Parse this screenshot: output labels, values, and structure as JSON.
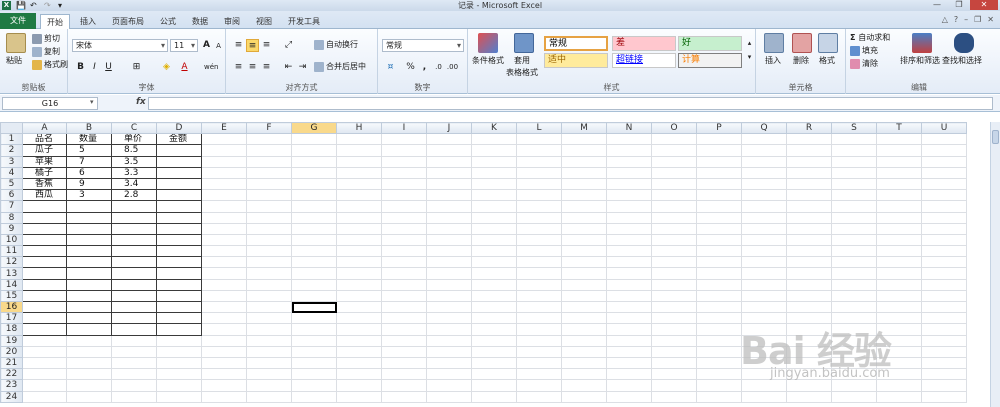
{
  "window": {
    "title": "记录 - Microsoft Excel",
    "minimize": "—",
    "restore": "❐",
    "close": "✕"
  },
  "tabs": {
    "file": "文件",
    "items": [
      "开始",
      "插入",
      "页面布局",
      "公式",
      "数据",
      "审阅",
      "视图",
      "开发工具"
    ],
    "active": "开始"
  },
  "ribbon": {
    "clipboard": {
      "label": "剪贴板",
      "paste": "粘贴",
      "cut": "剪切",
      "copy": "复制",
      "format_painter": "格式刷"
    },
    "font": {
      "label": "字体",
      "font_name": "宋体",
      "font_size": "11",
      "bold": "B",
      "italic": "I",
      "underline": "U",
      "grow": "A",
      "shrink": "A",
      "phonetic": "wén"
    },
    "alignment": {
      "label": "对齐方式",
      "wrap_text": "自动换行",
      "merge_center": "合并后居中"
    },
    "number": {
      "label": "数字",
      "format": "常规",
      "percent": "%",
      "comma": ","
    },
    "styles": {
      "label": "样式",
      "conditional": "条件格式",
      "table_format": "套用",
      "table_format2": "表格格式",
      "cells": [
        {
          "text": "常规",
          "bg": "#ffffff",
          "color": "#000000"
        },
        {
          "text": "差",
          "bg": "#ffc7ce",
          "color": "#9c0006"
        },
        {
          "text": "好",
          "bg": "#c6efce",
          "color": "#006100"
        },
        {
          "text": "适中",
          "bg": "#ffeb9c",
          "color": "#9c6500"
        },
        {
          "text": "超链接",
          "bg": "#ffffff",
          "color": "#0000ff"
        },
        {
          "text": "计算",
          "bg": "#f2f2f2",
          "color": "#fa7d00"
        }
      ]
    },
    "cells_group": {
      "label": "单元格",
      "insert": "插入",
      "delete": "删除",
      "format": "格式"
    },
    "editing": {
      "label": "编辑",
      "autosum": "自动求和",
      "fill": "填充",
      "clear": "清除",
      "sort_filter": "排序和筛选",
      "find_select": "查找和选择"
    }
  },
  "formula_bar": {
    "name_box": "G16",
    "fx": "fx",
    "value": ""
  },
  "sheet": {
    "columns": [
      "A",
      "B",
      "C",
      "D",
      "E",
      "F",
      "G",
      "H",
      "I",
      "J",
      "K",
      "L",
      "M",
      "N",
      "O",
      "P",
      "Q",
      "R",
      "S",
      "T",
      "U"
    ],
    "row_count": 24,
    "active_column": "G",
    "active_row": 16,
    "header_row": [
      "品名",
      "数量",
      "单价",
      "金额"
    ],
    "data": [
      [
        "瓜子",
        "5",
        "8.5",
        ""
      ],
      [
        "苹果",
        "7",
        "3.5",
        ""
      ],
      [
        "橘子",
        "6",
        "3.3",
        ""
      ],
      [
        "香蕉",
        "9",
        "3.4",
        ""
      ],
      [
        "西瓜",
        "3",
        "2.8",
        ""
      ]
    ],
    "bordered_rows": 18
  },
  "watermark": {
    "logo": "Bai 经验",
    "url": "jingyan.baidu.com"
  },
  "colors": {
    "file_tab": "#1f7a43",
    "active_cell_header": "#f9d98b",
    "close_button": "#c6463f"
  }
}
